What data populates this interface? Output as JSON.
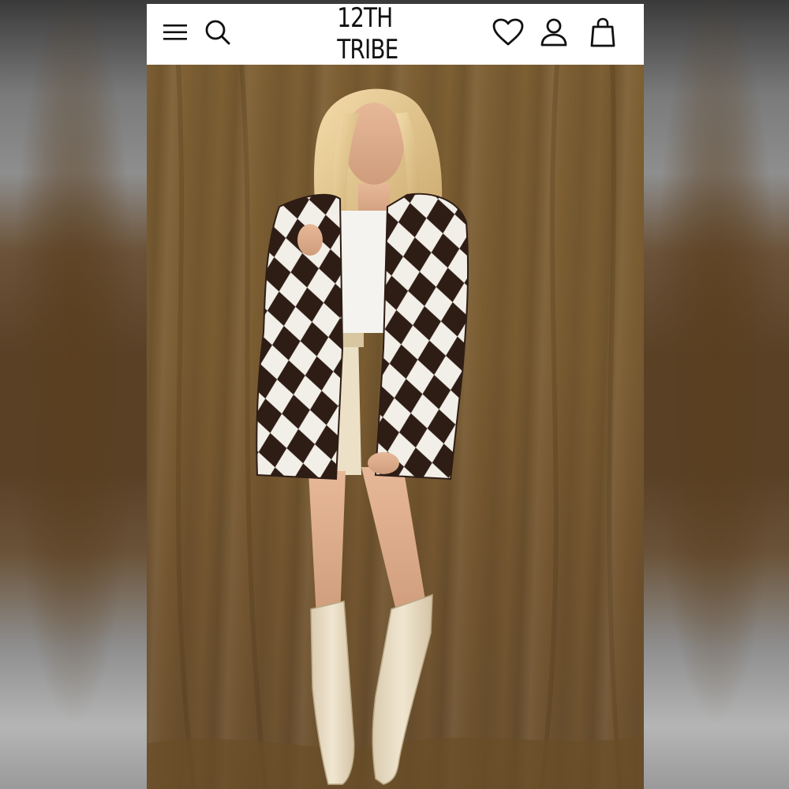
{
  "header": {
    "brand_logo": "12TH TRIBE",
    "menu_icon": "hamburger-menu-icon",
    "search_icon": "search-icon",
    "wishlist_icon": "heart-icon",
    "account_icon": "user-icon",
    "bag_icon": "shopping-bag-icon"
  },
  "hero": {
    "image_subject": "product-photo"
  },
  "colors": {
    "header_bg": "#ffffff",
    "backdrop": "#7a5c31",
    "coat_dark": "#2e1d15",
    "coat_light": "#f2efe8",
    "boots": "#e9dcc2"
  }
}
